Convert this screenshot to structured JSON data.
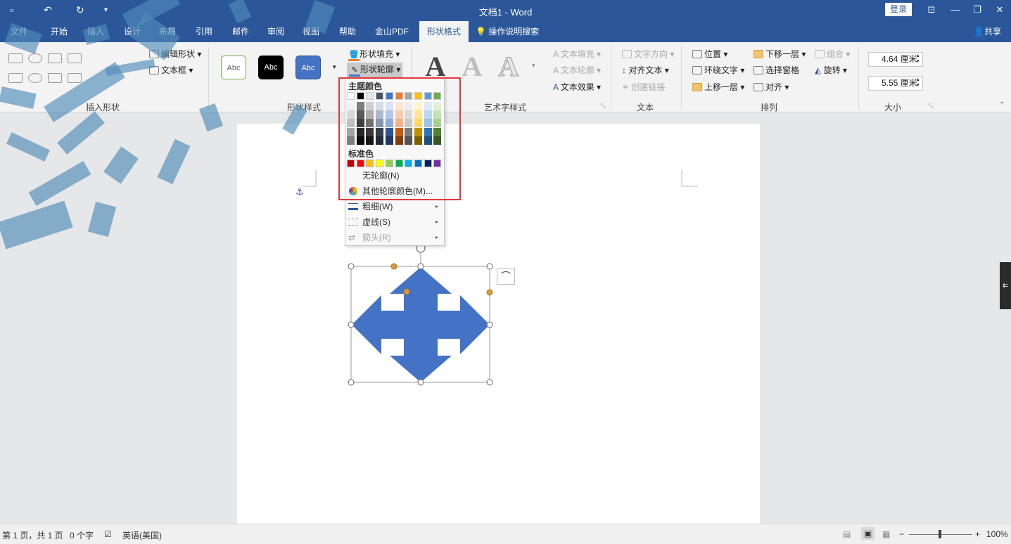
{
  "window": {
    "doc_title": "文档1  -  Word",
    "login_label": "登录",
    "colors": {
      "brand": "#2b579a",
      "shape_fill": "#4472c4",
      "handle": "#d89a3a",
      "highlight": "#e23a3a"
    }
  },
  "tabs": [
    {
      "label": "文件"
    },
    {
      "label": "开始"
    },
    {
      "label": "插入"
    },
    {
      "label": "设计"
    },
    {
      "label": "布局"
    },
    {
      "label": "引用"
    },
    {
      "label": "邮件"
    },
    {
      "label": "审阅"
    },
    {
      "label": "视图"
    },
    {
      "label": "帮助"
    },
    {
      "label": "金山PDF"
    },
    {
      "label": "形状格式",
      "active": true
    }
  ],
  "tell_me": "操作说明搜索",
  "share": "共享",
  "ribbon": {
    "insert_shapes": {
      "label": "插入形状",
      "edit_shape": "编辑形状",
      "text_box": "文本框"
    },
    "shape_styles": {
      "label": "形状样式",
      "presets": [
        "Abc",
        "Abc",
        "Abc"
      ],
      "shape_fill": "形状填充",
      "shape_outline": "形状轮廓"
    },
    "wordart": {
      "label": "艺术字样式",
      "letters": [
        "A",
        "A",
        "A"
      ],
      "text_fill": "文本填充",
      "text_outline": "文本轮廓",
      "text_effects": "文本效果"
    },
    "text": {
      "label": "文本",
      "direction": "文字方向",
      "align": "对齐文本",
      "link": "创建链接"
    },
    "arrange": {
      "label": "排列",
      "position": "位置",
      "wrap": "环绕文字",
      "bring_forward": "上移一层",
      "send_backward": "下移一层",
      "selection_pane": "选择窗格",
      "align": "对齐",
      "group": "组合",
      "rotate": "旋转"
    },
    "size": {
      "label": "大小",
      "height": "4.64 厘米",
      "width": "5.55 厘米"
    }
  },
  "dropdown": {
    "theme_colors_label": "主题颜色",
    "standard_colors_label": "标准色",
    "theme_top_row": [
      "#ffffff",
      "#000000",
      "#e7e6e6",
      "#44546a",
      "#4472c4",
      "#ed7d31",
      "#a5a5a5",
      "#ffc000",
      "#5b9bd5",
      "#70ad47"
    ],
    "theme_shades": [
      [
        "#f2f2f2",
        "#7f7f7f",
        "#d0cece",
        "#d6dce4",
        "#d9e2f3",
        "#fbe5d5",
        "#ededed",
        "#fff2cc",
        "#ddebf7",
        "#e2efd9"
      ],
      [
        "#d8d8d8",
        "#595959",
        "#aeabab",
        "#adb9ca",
        "#b4c6e7",
        "#f7cbac",
        "#dbdbdb",
        "#fee599",
        "#bdd7ee",
        "#c5e0b3"
      ],
      [
        "#bfbfbf",
        "#3f3f3f",
        "#757070",
        "#8496b0",
        "#8eaadb",
        "#f4b183",
        "#c9c9c9",
        "#ffd966",
        "#9cc3e5",
        "#a8d08d"
      ],
      [
        "#a5a5a5",
        "#262626",
        "#3a3838",
        "#323f4f",
        "#2f5496",
        "#c55a11",
        "#7b7b7b",
        "#bf9000",
        "#2e75b5",
        "#538135"
      ],
      [
        "#7f7f7f",
        "#0c0c0c",
        "#171616",
        "#222a35",
        "#1f3864",
        "#833c0b",
        "#525252",
        "#7f6000",
        "#1e4e79",
        "#375623"
      ]
    ],
    "standard_colors": [
      "#c00000",
      "#ff0000",
      "#ffc000",
      "#ffff00",
      "#92d050",
      "#00b050",
      "#00b0f0",
      "#0070c0",
      "#002060",
      "#7030a0"
    ],
    "no_outline": "无轮廓(N)",
    "more_colors": "其他轮廓颜色(M)...",
    "weight": "粗细(W)",
    "dashes": "虚线(S)",
    "arrows": "箭头(R)"
  },
  "statusbar": {
    "page": "第 1 页，共 1 页",
    "words": "0 个字",
    "language": "英语(美国)",
    "zoom": "100%"
  }
}
